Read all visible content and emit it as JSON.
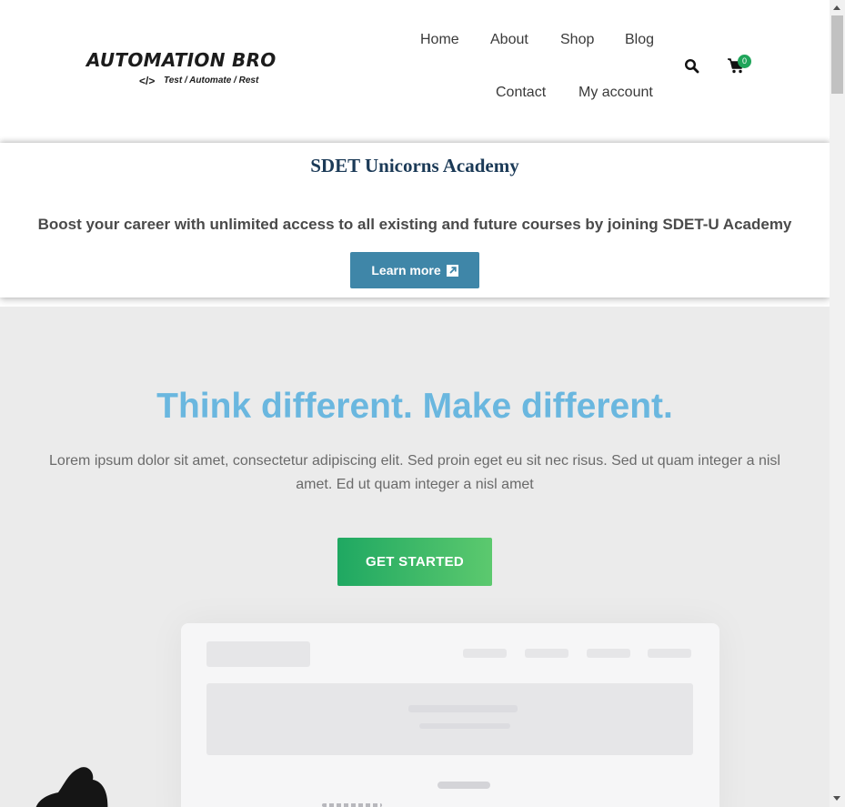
{
  "header": {
    "logo": {
      "main": "AUTOMATION BRO",
      "code": "</>",
      "tagline": "Test / Automate / Rest"
    },
    "nav": [
      "Home",
      "About",
      "Shop",
      "Blog",
      "Contact",
      "My account"
    ],
    "search_icon": "search-icon",
    "cart_icon": "cart-icon",
    "cart_count": "0"
  },
  "banner": {
    "title": "SDET Unicorns Academy",
    "text": "Boost your career with unlimited access to all existing and future courses by joining SDET-U Academy",
    "button_label": "Learn more",
    "button_icon": "external-link-icon"
  },
  "hero": {
    "title": "Think different. Make different.",
    "text": "Lorem ipsum dolor sit amet, consectetur adipiscing elit. Sed proin eget eu sit nec risus. Sed ut quam integer a nisl amet.  Ed ut quam integer a nisl amet",
    "button_label": "GET STARTED"
  },
  "colors": {
    "accent_blue": "#6ab7df",
    "button_blue": "#3f86a8",
    "green": "#1fa862",
    "banner_title": "#1b3a57"
  }
}
